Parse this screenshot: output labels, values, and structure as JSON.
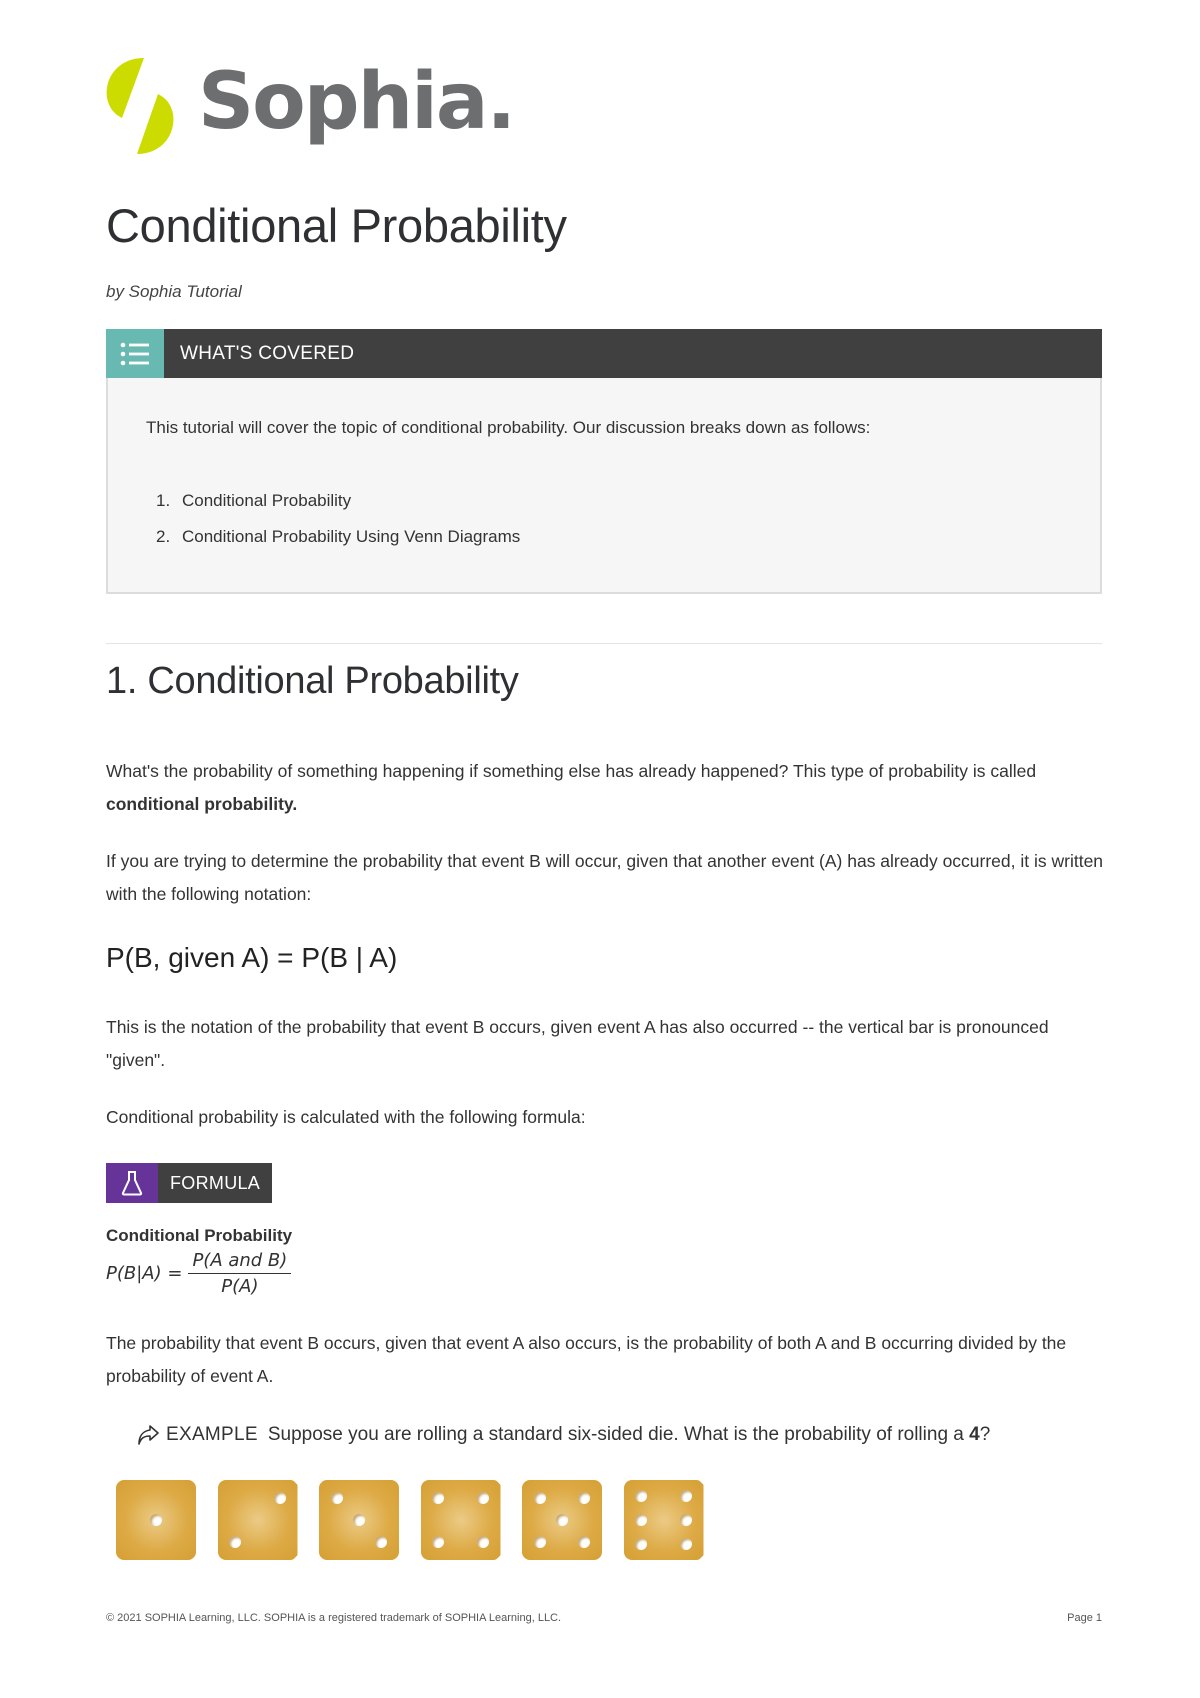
{
  "brand": {
    "name": "Sophia",
    "dot": ".",
    "colors": {
      "mark": "#cddc00",
      "wordmark": "#6d6e70"
    }
  },
  "document": {
    "title": "Conditional Probability",
    "byline": "by Sophia Tutorial"
  },
  "whats_covered": {
    "label": "WHAT'S COVERED",
    "icon": "list-icon",
    "intro": "This tutorial will cover the topic of conditional probability. Our discussion breaks down as follows:",
    "items": [
      {
        "num": "1.",
        "text": "Conditional Probability"
      },
      {
        "num": "2.",
        "text": "Conditional Probability Using Venn Diagrams"
      }
    ],
    "colors": {
      "icon_bg": "#68b9b1",
      "header_bg": "#404040",
      "body_bg": "#f6f6f6"
    }
  },
  "section1": {
    "heading": "1. Conditional Probability",
    "p1_text": "What's the probability of something happening if something else has already happened? This type of probability is called ",
    "p1_bold": "conditional probability.",
    "p2": "If you are trying to determine the probability that event B will occur, given that another event (A) has already occurred, it is written with the following notation:",
    "notation": "P(B, given A) = P(B | A)",
    "p3": "This is the notation of the probability that event B occurs, given event A has also occurred -- the vertical bar is pronounced \"given\".",
    "p4": "Conditional probability is calculated with the following formula:",
    "formula": {
      "badge": "FORMULA",
      "icon": "flask-icon",
      "badge_color": "#663399",
      "title": "Conditional Probability",
      "lhs": "P(B|A) =",
      "numerator": "P(A and B)",
      "denominator": "P(A)"
    },
    "p5": "The probability that event B occurs, given that event A also occurs, is the probability of both A and B occurring divided by the probability of event A.",
    "example": {
      "icon": "share-arrow-icon",
      "tag": "EXAMPLE",
      "text": "Suppose you are rolling a standard six-sided die. What is the probability of rolling a ",
      "bold": "4",
      "end": "?"
    },
    "dice": [
      1,
      2,
      3,
      4,
      5,
      6
    ]
  },
  "footer": {
    "copyright": "© 2021 SOPHIA Learning, LLC. SOPHIA is a registered trademark of SOPHIA Learning, LLC.",
    "page": "Page 1"
  }
}
